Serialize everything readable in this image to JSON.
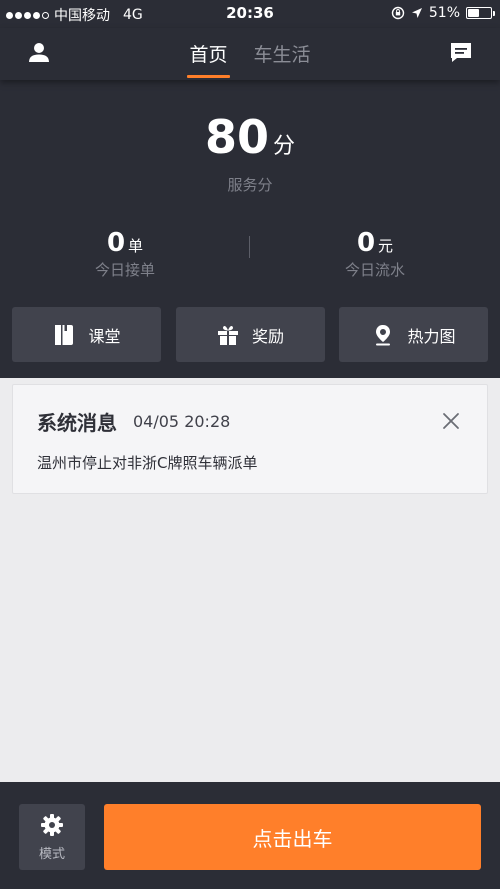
{
  "status_bar": {
    "carrier": "中国移动",
    "network": "4G",
    "time": "20:36",
    "battery_text": "51%",
    "battery_level": 51
  },
  "nav": {
    "tabs": [
      {
        "label": "首页",
        "active": true
      },
      {
        "label": "车生活",
        "active": false
      }
    ]
  },
  "dashboard": {
    "score_value": "80",
    "score_unit": "分",
    "score_label": "服务分",
    "orders": {
      "value": "0",
      "unit": "单",
      "label": "今日接单"
    },
    "income": {
      "value": "0",
      "unit": "元",
      "label": "今日流水"
    },
    "quick_actions": [
      {
        "label": "课堂",
        "icon": "book-icon"
      },
      {
        "label": "奖励",
        "icon": "gift-icon"
      },
      {
        "label": "热力图",
        "icon": "location-pin-icon"
      }
    ]
  },
  "message": {
    "title": "系统消息",
    "time": "04/05 20:28",
    "body": "温州市停止对非浙C牌照车辆派单"
  },
  "bottom": {
    "mode_label": "模式",
    "depart_label": "点击出车"
  },
  "colors": {
    "accent": "#ff7f2a",
    "dark_bg": "#2b2d36",
    "button_bg": "#41434d"
  }
}
